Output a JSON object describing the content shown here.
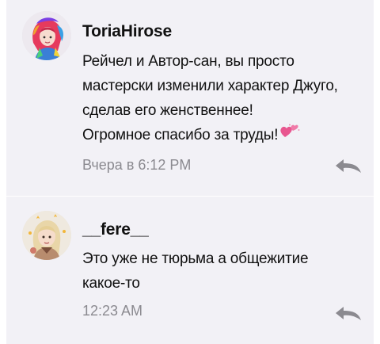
{
  "comments": [
    {
      "username": "ToriaHirose",
      "lines": [
        "Рейчел и Автор-сан, вы просто",
        "мастерски изменили характер Джуго,",
        "сделав его женственнее!",
        "Огромное спасибо за труды!"
      ],
      "emoji": "heart-icon",
      "time": "Вчера в 6:12 PM",
      "reply_icon": "reply-icon"
    },
    {
      "username": "__fere__",
      "lines": [
        "Это уже не тюрьма а общежитие",
        "какое-то"
      ],
      "time": "12:23 AM",
      "reply_icon": "reply-icon"
    }
  ],
  "colors": {
    "panel_bg": "#f2f1f6",
    "text": "#111111",
    "muted": "#8b8a90",
    "heart": "#e8568f"
  }
}
